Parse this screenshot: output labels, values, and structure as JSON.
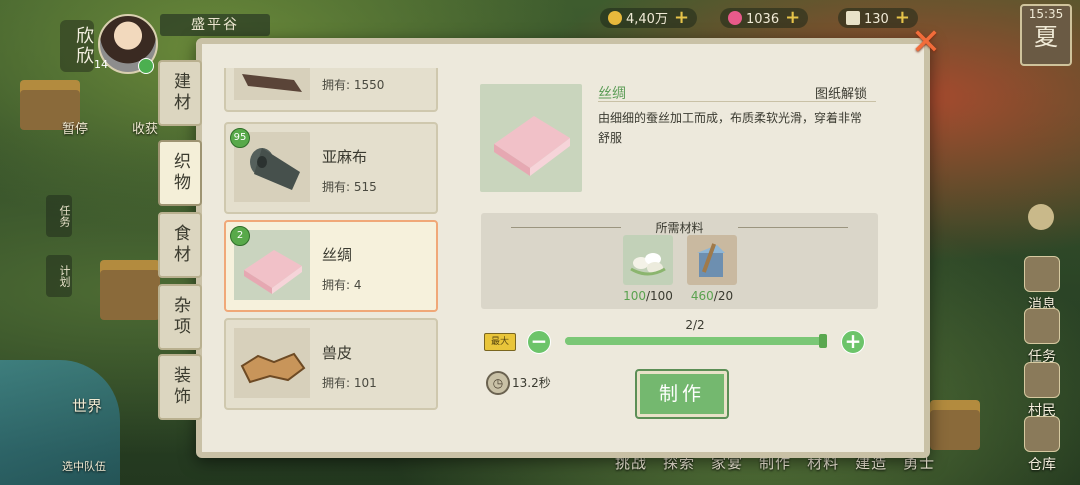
{
  "player": {
    "name": "欣欣",
    "level": "14",
    "location": "盛平谷"
  },
  "resources": [
    {
      "value": "4,40万",
      "icon": "coin-icon",
      "color": "#e7b93c"
    },
    {
      "value": "1036",
      "icon": "gem-icon",
      "color": "#e85a8a"
    },
    {
      "value": "130",
      "icon": "ticket-icon",
      "color": "#e8e2c8"
    }
  ],
  "clock": {
    "time": "15:35",
    "season": "夏"
  },
  "left_hud": {
    "pause": "暂停",
    "harvest": "收获",
    "task": "任务",
    "plan": "计划",
    "world": "世界",
    "team": "选中队伍"
  },
  "bottom_nav": [
    "挑战",
    "探索",
    "家宴",
    "制作",
    "材料",
    "建造",
    "勇士"
  ],
  "right_hud": [
    "消息",
    "任务",
    "村民",
    "仓库"
  ],
  "tabs": [
    {
      "label": "建材",
      "active": false
    },
    {
      "label": "织物",
      "active": true
    },
    {
      "label": "食材",
      "active": false
    },
    {
      "label": "杂项",
      "active": false
    },
    {
      "label": "装饰",
      "active": false
    }
  ],
  "items": [
    {
      "name": "",
      "own_label": "拥有: 1550",
      "badge": "",
      "icon": "cloth-brown-icon"
    },
    {
      "name": "亚麻布",
      "own_label": "拥有: 515",
      "badge": "95",
      "icon": "linen-roll-icon"
    },
    {
      "name": "丝绸",
      "own_label": "拥有: 4",
      "badge": "2",
      "icon": "silk-icon",
      "selected": true
    },
    {
      "name": "兽皮",
      "own_label": "拥有: 101",
      "badge": "",
      "icon": "hide-icon"
    }
  ],
  "detail": {
    "name": "丝绸",
    "unlock_label": "图纸解锁",
    "description": "由细细的蚕丝加工而成，布质柔软光滑，穿着非常舒服",
    "materials_title": "所需材料",
    "materials": [
      {
        "icon": "silk-cocoon-icon",
        "have": "100",
        "need": "100"
      },
      {
        "icon": "water-bucket-icon",
        "have": "460",
        "need": "20"
      }
    ],
    "max_label": "最大",
    "count": "2/2",
    "quantity_fraction": 1.0,
    "time": "13.2秒",
    "make_label": "制作"
  },
  "close_label": "✕"
}
